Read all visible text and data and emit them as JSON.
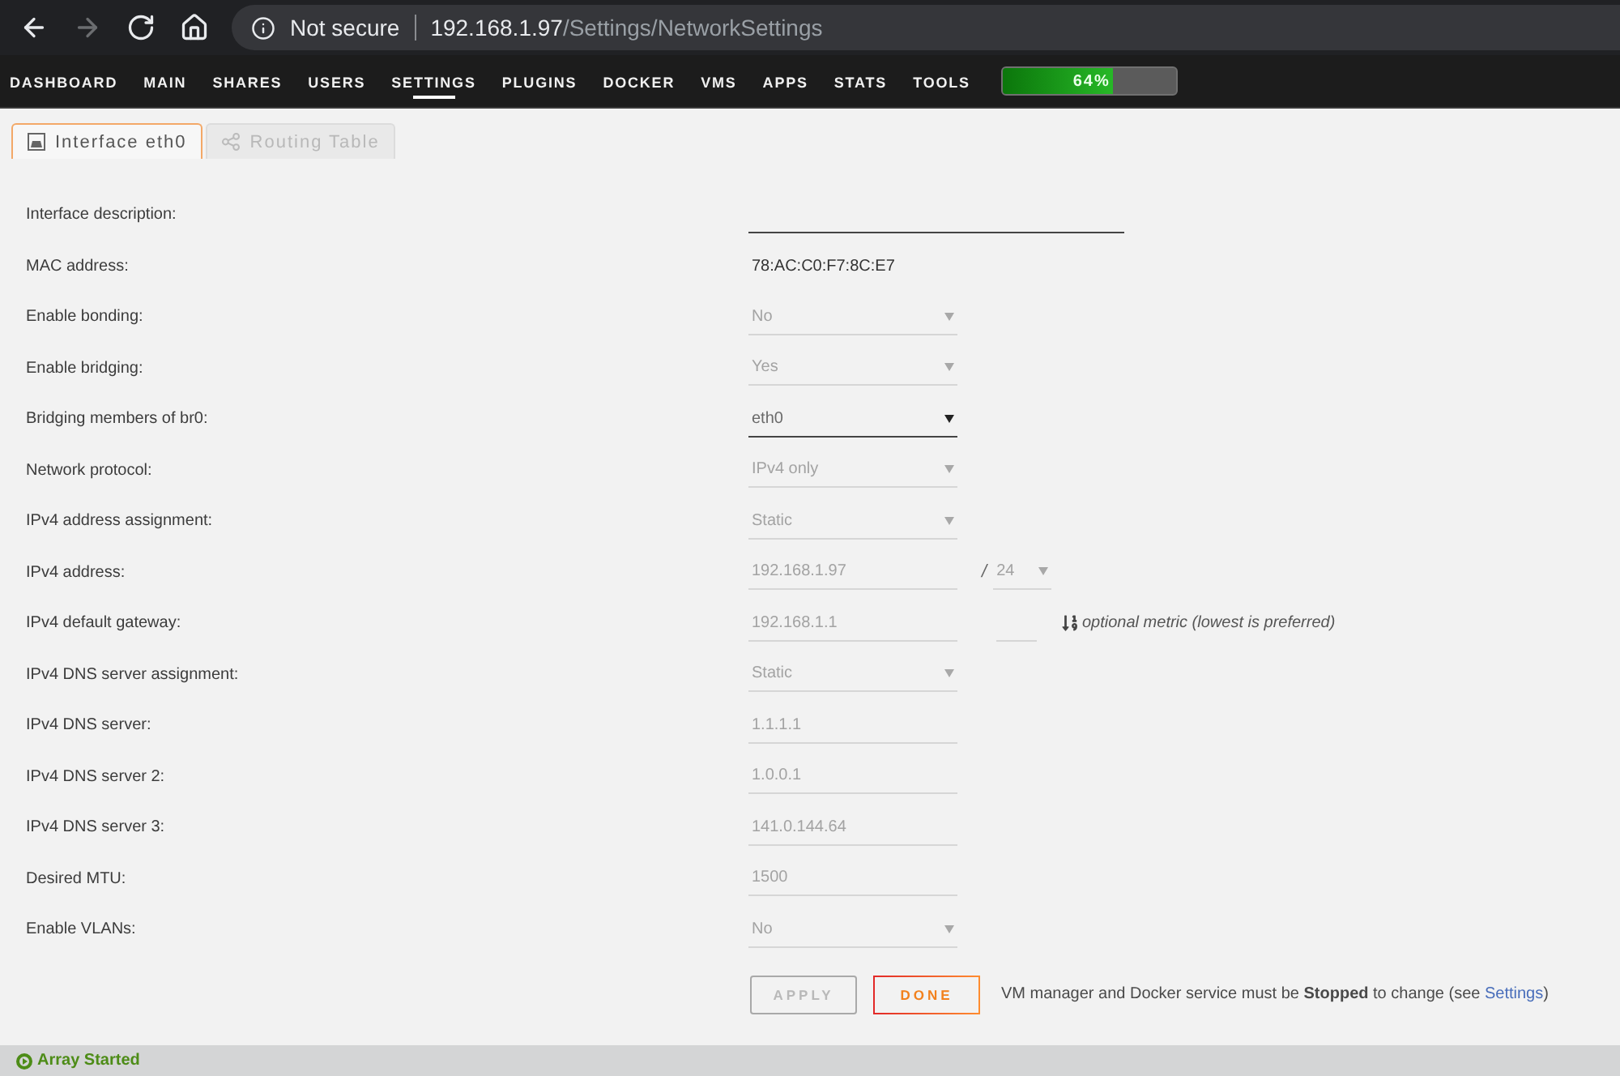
{
  "browser": {
    "nav_buttons": [
      {
        "kind": "back",
        "disabled": false
      },
      {
        "kind": "forward",
        "disabled": true
      },
      {
        "kind": "reload",
        "disabled": false
      },
      {
        "kind": "home",
        "disabled": false
      }
    ],
    "address": {
      "security": "Not secure",
      "host": "192.168.1.97",
      "path": "/Settings/NetworkSettings"
    }
  },
  "menu": {
    "items": [
      {
        "label": "DASHBOARD",
        "selected": false
      },
      {
        "label": "MAIN",
        "selected": false
      },
      {
        "label": "SHARES",
        "selected": false
      },
      {
        "label": "USERS",
        "selected": false
      },
      {
        "label": "SETTINGS",
        "selected": true
      },
      {
        "label": "PLUGINS",
        "selected": false
      },
      {
        "label": "DOCKER",
        "selected": false
      },
      {
        "label": "VMS",
        "selected": false
      },
      {
        "label": "APPS",
        "selected": false
      },
      {
        "label": "STATS",
        "selected": false
      },
      {
        "label": "TOOLS",
        "selected": false
      }
    ],
    "usage": {
      "label": "64%",
      "level": 0.64
    }
  },
  "tabs": [
    {
      "kind": "interface",
      "label": "Interface eth0",
      "selected": true
    },
    {
      "kind": "routing",
      "label": "Routing Table",
      "selected": false
    }
  ],
  "form": {
    "rows": [
      {
        "label": "Interface description:",
        "field": {
          "kind": "long_text",
          "disabled": false
        }
      },
      {
        "label": "MAC address:",
        "field": {
          "kind": "static",
          "value": "78:AC:C0:F7:8C:E7"
        }
      },
      {
        "label": "Enable bonding:",
        "field": {
          "kind": "select",
          "value": "No",
          "disabled": true
        }
      },
      {
        "label": "Enable bridging:",
        "field": {
          "kind": "select",
          "value": "Yes",
          "disabled": true
        }
      },
      {
        "label": "Bridging members of br0:",
        "field": {
          "kind": "select",
          "value": "eth0",
          "disabled": false
        }
      },
      {
        "label": "Network protocol:",
        "field": {
          "kind": "select",
          "value": "IPv4 only",
          "disabled": true
        }
      },
      {
        "label": "IPv4 address assignment:",
        "field": {
          "kind": "select",
          "value": "Static",
          "disabled": true
        }
      },
      {
        "label": "IPv4 address:",
        "field": {
          "kind": "text",
          "value": "192.168.1.97",
          "disabled": true
        },
        "extra": {
          "kind": "prefix",
          "separator": "/",
          "value": "24",
          "disabled": true
        }
      },
      {
        "label": "IPv4 default gateway:",
        "field": {
          "kind": "text",
          "value": "192.168.1.1",
          "disabled": true
        },
        "extra": {
          "kind": "metric",
          "disabled": true,
          "note": "optional metric (lowest is preferred)"
        }
      },
      {
        "label": "IPv4 DNS server assignment:",
        "field": {
          "kind": "select",
          "value": "Static",
          "disabled": true
        }
      },
      {
        "label": "IPv4 DNS server:",
        "field": {
          "kind": "text",
          "value": "1.1.1.1",
          "disabled": true
        }
      },
      {
        "label": "IPv4 DNS server 2:",
        "field": {
          "kind": "text",
          "value": "1.0.0.1",
          "disabled": true
        }
      },
      {
        "label": "IPv4 DNS server 3:",
        "field": {
          "kind": "text",
          "value": "141.0.144.64",
          "disabled": true
        }
      },
      {
        "label": "Desired MTU:",
        "field": {
          "kind": "text",
          "value": "1500",
          "disabled": true
        }
      },
      {
        "label": "Enable VLANs:",
        "field": {
          "kind": "select",
          "value": "No",
          "disabled": true
        }
      }
    ]
  },
  "actions": {
    "buttons": [
      {
        "label": "APPLY",
        "disabled": true
      },
      {
        "label": "DONE",
        "disabled": false
      }
    ],
    "note": {
      "text": "VM manager and Docker service must be **Stopped** to change (see",
      "link": "Settings",
      "closing": ")"
    }
  },
  "status_bar": {
    "text": "Array Started"
  }
}
